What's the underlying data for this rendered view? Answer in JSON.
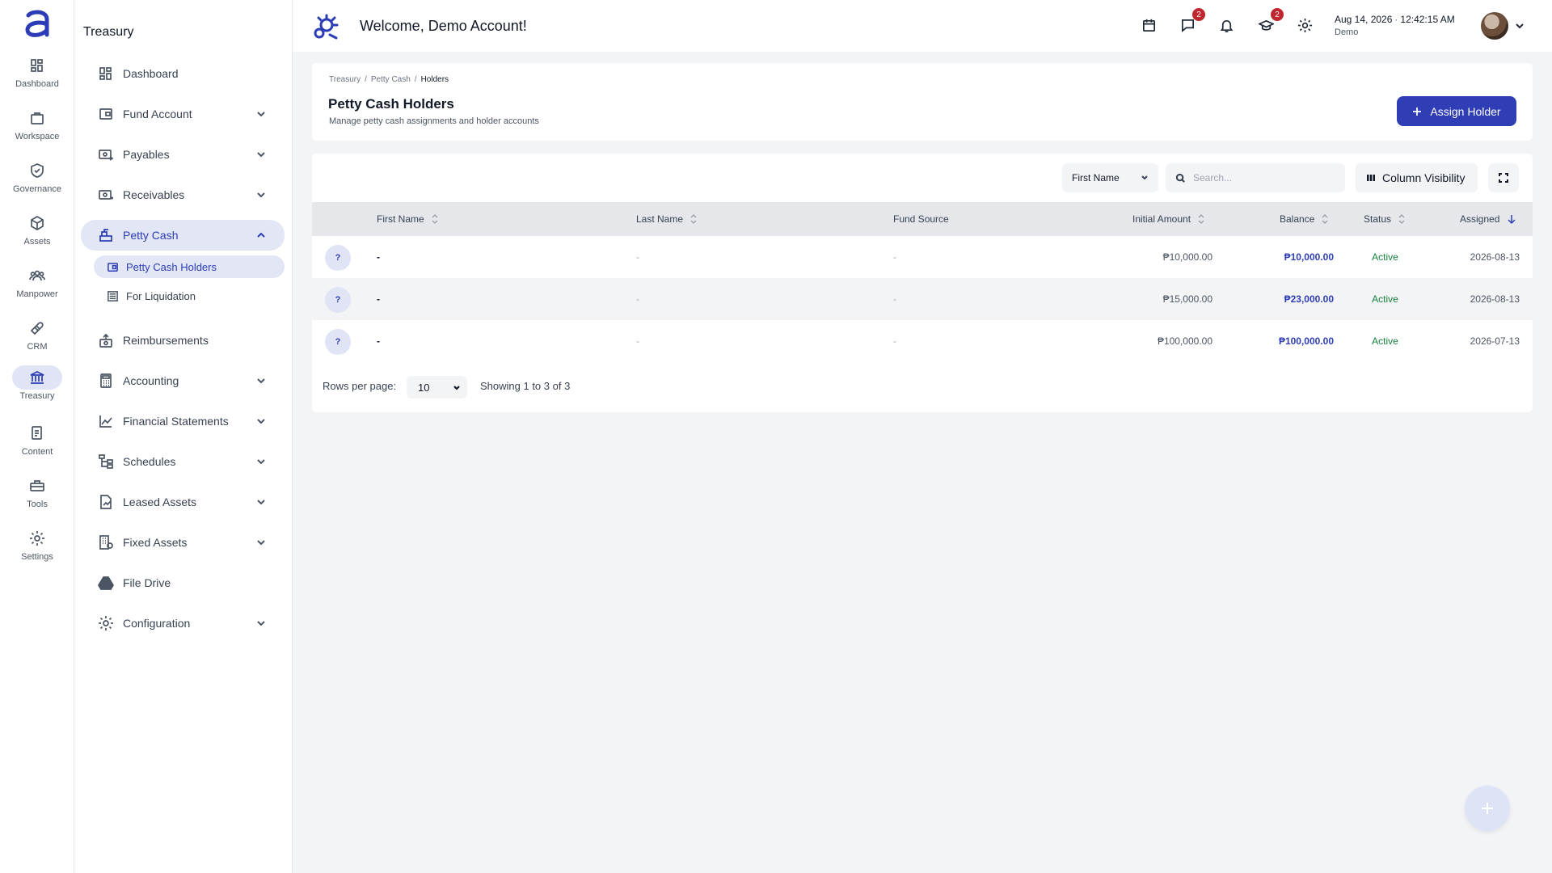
{
  "rail": {
    "items": [
      {
        "label": "Dashboard",
        "icon": "grid-icon"
      },
      {
        "label": "Workspace",
        "icon": "briefcase-icon"
      },
      {
        "label": "Governance",
        "icon": "shield-check-icon"
      },
      {
        "label": "Assets",
        "icon": "cube-icon"
      },
      {
        "label": "Manpower",
        "icon": "people-icon"
      },
      {
        "label": "CRM",
        "icon": "handshake-icon"
      },
      {
        "label": "Treasury",
        "icon": "bank-icon"
      },
      {
        "label": "Content",
        "icon": "document-icon"
      },
      {
        "label": "Tools",
        "icon": "toolbox-icon"
      },
      {
        "label": "Settings",
        "icon": "gear-icon"
      }
    ],
    "active": "Treasury"
  },
  "sidebar": {
    "title": "Treasury",
    "items": [
      {
        "label": "Dashboard"
      },
      {
        "label": "Fund Account"
      },
      {
        "label": "Payables"
      },
      {
        "label": "Receivables"
      },
      {
        "label": "Petty Cash"
      },
      {
        "label": "Reimbursements"
      },
      {
        "label": "Accounting"
      },
      {
        "label": "Financial Statements"
      },
      {
        "label": "Schedules"
      },
      {
        "label": "Leased Assets"
      },
      {
        "label": "Fixed Assets"
      },
      {
        "label": "File Drive"
      },
      {
        "label": "Configuration"
      }
    ],
    "sub_items": [
      {
        "label": "Petty Cash Holders"
      },
      {
        "label": "For Liquidation"
      }
    ]
  },
  "header": {
    "welcome": "Welcome, Demo Account!",
    "messages_badge": "2",
    "learning_badge": "2",
    "date": "Aug 14, 2026",
    "time": "12:42:15 AM",
    "user": "Demo"
  },
  "page": {
    "breadcrumb": [
      "Treasury",
      "Petty Cash",
      "Holders"
    ],
    "title": "Petty Cash Holders",
    "subtitle": "Manage petty cash assignments and holder accounts",
    "assign_button": "Assign Holder"
  },
  "toolbar": {
    "filter_field": "First Name",
    "search_placeholder": "Search...",
    "column_visibility": "Column Visibility"
  },
  "table": {
    "columns": [
      "First Name",
      "Last Name",
      "Fund Source",
      "Initial Amount",
      "Balance",
      "Status",
      "Assigned"
    ],
    "rows": [
      {
        "avatar": "?",
        "first_name": "-",
        "last_name": "-",
        "fund_source": "-",
        "initial_amount": "₱10,000.00",
        "balance": "₱10,000.00",
        "status": "Active",
        "assigned": "2026-08-13"
      },
      {
        "avatar": "?",
        "first_name": "-",
        "last_name": "-",
        "fund_source": "-",
        "initial_amount": "₱15,000.00",
        "balance": "₱23,000.00",
        "status": "Active",
        "assigned": "2026-08-13"
      },
      {
        "avatar": "?",
        "first_name": "-",
        "last_name": "-",
        "fund_source": "-",
        "initial_amount": "₱100,000.00",
        "balance": "₱100,000.00",
        "status": "Active",
        "assigned": "2026-07-13"
      }
    ]
  },
  "pagination": {
    "rows_per_page_label": "Rows per page:",
    "rows_per_page": "10",
    "showing": "Showing 1 to 3 of 3"
  },
  "colors": {
    "accent": "#2f3eb5",
    "active_bg": "#e3e6f4",
    "status_active": "#15803d",
    "badge": "#c0262d"
  }
}
